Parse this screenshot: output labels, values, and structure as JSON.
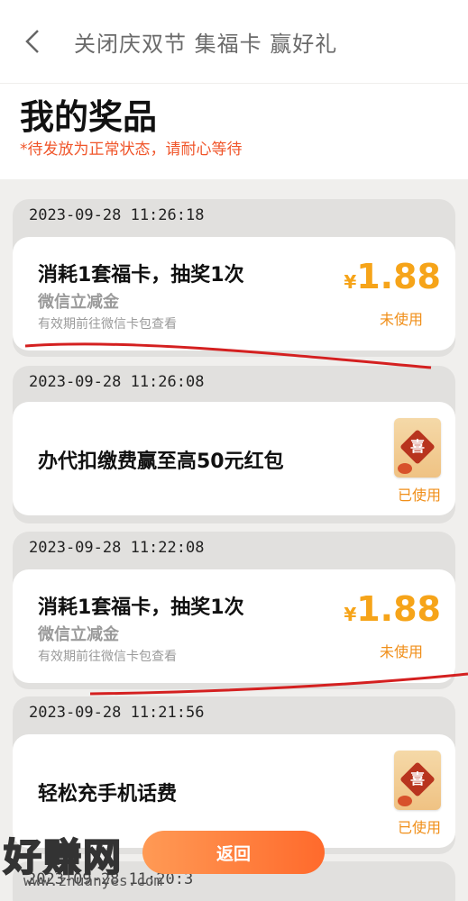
{
  "nav": {
    "title": "关闭庆双节 集福卡 赢好礼"
  },
  "header": {
    "title": "我的奖品",
    "note": "*待发放为正常状态，请耐心等待"
  },
  "prizes": [
    {
      "time": "2023-09-28 11:26:18",
      "title": "消耗1套福卡，抽奖1次",
      "subtitle": "微信立减金",
      "note": "有效期前往微信卡包查看",
      "currency": "¥",
      "amount": "1.88",
      "status": "未使用"
    },
    {
      "time": "2023-09-28 11:26:08",
      "title": "办代扣缴费赢至高50元红包",
      "stamp_char": "喜",
      "status": "已使用"
    },
    {
      "time": "2023-09-28 11:22:08",
      "title": "消耗1套福卡，抽奖1次",
      "subtitle": "微信立减金",
      "note": "有效期前往微信卡包查看",
      "currency": "¥",
      "amount": "1.88",
      "status": "未使用"
    },
    {
      "time": "2023-09-28 11:21:56",
      "title": "轻松充手机话费",
      "stamp_char": "喜",
      "status": "已使用"
    }
  ],
  "footer": {
    "return_label": "返回",
    "partial_time": "2023-09-28 11:20:3"
  },
  "watermark": {
    "text": "好赚网",
    "url": "www.zhuanyes.com"
  },
  "colors": {
    "accent": "#f6a419",
    "note_red": "#f0552a",
    "button": "#ff7a3a",
    "annotation_line": "#d42020"
  }
}
